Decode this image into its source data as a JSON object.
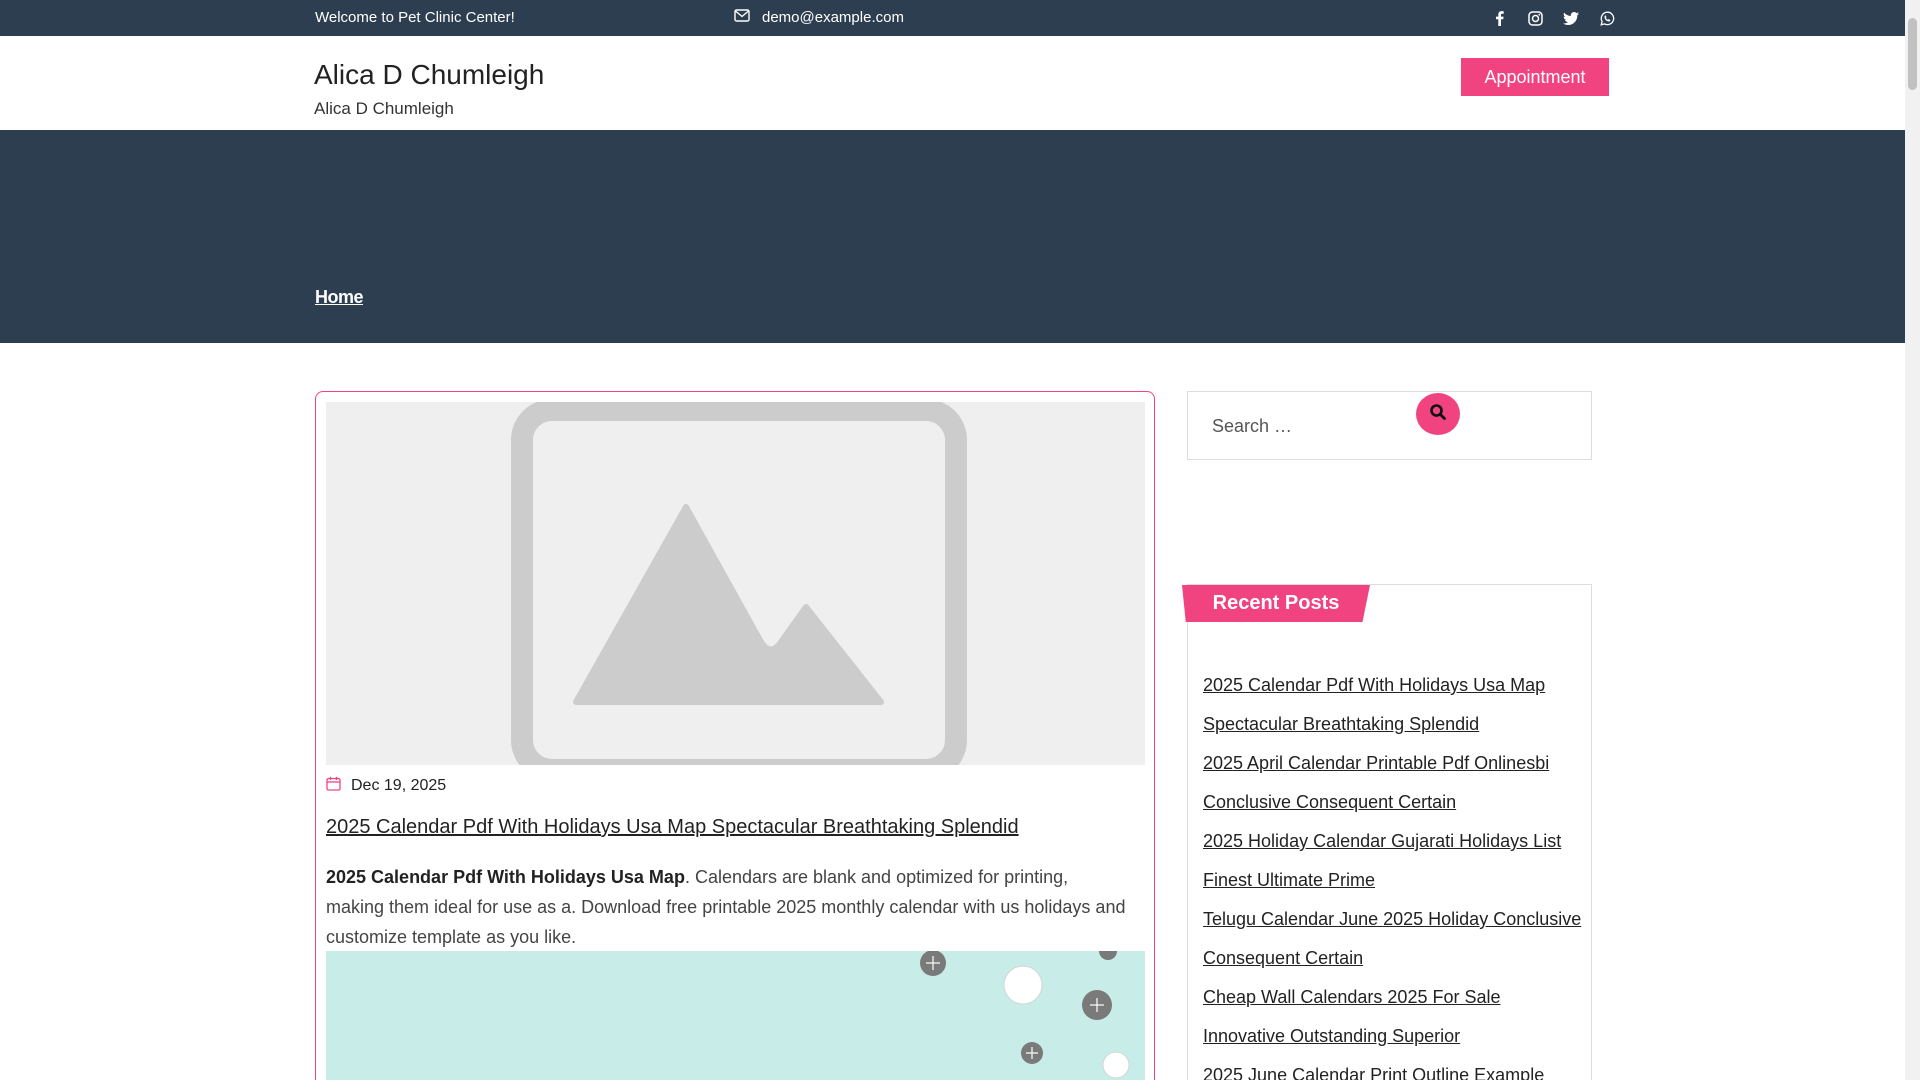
{
  "topbar": {
    "welcome": "Welcome to Pet Clinic Center!",
    "email": "demo@example.com",
    "socials": [
      "facebook-icon",
      "instagram-icon",
      "twitter-icon",
      "whatsapp-icon"
    ]
  },
  "header": {
    "site_title": "Alica D Chumleigh",
    "tagline": "Alica D Chumleigh",
    "appointment_label": "Appointment"
  },
  "banner": {
    "breadcrumb": "Home"
  },
  "post": {
    "date": "Dec 19, 2025",
    "title": "2025 Calendar Pdf With Holidays Usa Map Spectacular Breathtaking Splendid",
    "excerpt_bold": "2025 Calendar Pdf With Holidays Usa Map",
    "excerpt_rest": ". Calendars are blank and optimized for printing, making them ideal for use as a. Download free printable 2025 monthly calendar with us holidays and customize template as you like."
  },
  "sidebar": {
    "search_placeholder": "Search …",
    "recent_heading": "Recent Posts",
    "recent_posts": [
      "2025 Calendar Pdf With Holidays Usa Map Spectacular Breathtaking Splendid",
      "2025 April Calendar Printable Pdf Onlinesbi Conclusive Consequent Certain",
      "2025 Holiday Calendar Gujarati Holidays List Finest Ultimate Prime",
      "Telugu Calendar June 2025 Holiday Conclusive Consequent Certain",
      "Cheap Wall Calendars 2025 For Sale Innovative Outstanding Superior",
      "2025 June Calendar Print Outline Example"
    ]
  },
  "colors": {
    "accent": "#f0437f",
    "dark": "#2c3e50"
  }
}
